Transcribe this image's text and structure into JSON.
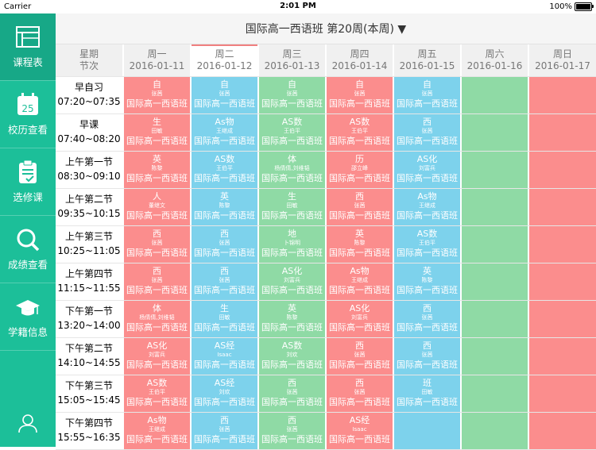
{
  "status_bar": {
    "carrier": "Carrier",
    "time": "2:01 PM",
    "battery": "100%"
  },
  "sidebar": {
    "items": [
      {
        "label": "课程表",
        "icon": "timetable-icon",
        "active": true
      },
      {
        "label": "校历查看",
        "icon": "calendar-icon",
        "day": "25"
      },
      {
        "label": "选修课",
        "icon": "elective-list-icon"
      },
      {
        "label": "成绩查看",
        "icon": "search-icon"
      },
      {
        "label": "学籍信息",
        "icon": "graduation-cap-icon"
      }
    ],
    "profile_icon": "user-icon"
  },
  "header": {
    "title": "国际高一西语班  第20周(本周) ▼"
  },
  "grid": {
    "corner": {
      "line1": "星期",
      "line2": "节次"
    },
    "days": [
      {
        "name": "周一",
        "date": "2016-01-11"
      },
      {
        "name": "周二",
        "date": "2016-01-12",
        "today": true
      },
      {
        "name": "周三",
        "date": "2016-01-13"
      },
      {
        "name": "周四",
        "date": "2016-01-14"
      },
      {
        "name": "周五",
        "date": "2016-01-15"
      },
      {
        "name": "周六",
        "date": "2016-01-16"
      },
      {
        "name": "周日",
        "date": "2016-01-17"
      }
    ],
    "periods": [
      {
        "name": "早自习",
        "time": "07:20~07:35"
      },
      {
        "name": "早课",
        "time": "07:40~08:20"
      },
      {
        "name": "上午第一节",
        "time": "08:30~09:10"
      },
      {
        "name": "上午第二节",
        "time": "09:35~10:15"
      },
      {
        "name": "上午第三节",
        "time": "10:25~11:05"
      },
      {
        "name": "上午第四节",
        "time": "11:15~11:55"
      },
      {
        "name": "下午第一节",
        "time": "13:20~14:00"
      },
      {
        "name": "下午第二节",
        "time": "14:10~14:55"
      },
      {
        "name": "下午第三节",
        "time": "15:05~15:45"
      },
      {
        "name": "下午第四节",
        "time": "15:55~16:35"
      }
    ],
    "day_colors": [
      "red",
      "blue",
      "green",
      "red",
      "blue",
      "green",
      "red"
    ],
    "colors": {
      "red": "#fb8d8d",
      "blue": "#7dd2ec",
      "green": "#8fdaa5",
      "sidebar": "#1cbf99"
    },
    "class_name": "国际高一西语班",
    "schedule": [
      [
        {
          "s": "自",
          "t": "张茜"
        },
        {
          "s": "自",
          "t": "张茜"
        },
        {
          "s": "自",
          "t": "张茜"
        },
        {
          "s": "自",
          "t": "张茜"
        },
        {
          "s": "自",
          "t": "张茜"
        },
        null,
        null
      ],
      [
        {
          "s": "生",
          "t": "田敏"
        },
        {
          "s": "As物",
          "t": "王继成"
        },
        {
          "s": "AS数",
          "t": "王伯平"
        },
        {
          "s": "AS数",
          "t": "王伯平"
        },
        {
          "s": "西",
          "t": "张茜"
        },
        null,
        null
      ],
      [
        {
          "s": "英",
          "t": "陈黎"
        },
        {
          "s": "AS数",
          "t": "王伯平"
        },
        {
          "s": "体",
          "t": "杨倩倩,刘维韬"
        },
        {
          "s": "历",
          "t": "邵立峰"
        },
        {
          "s": "AS化",
          "t": "刘富兵"
        },
        null,
        null
      ],
      [
        {
          "s": "人",
          "t": "董继文"
        },
        {
          "s": "英",
          "t": "陈黎"
        },
        {
          "s": "生",
          "t": "田敏"
        },
        {
          "s": "西",
          "t": "张茜"
        },
        {
          "s": "As物",
          "t": "王继成"
        },
        null,
        null
      ],
      [
        {
          "s": "西",
          "t": "张茜"
        },
        {
          "s": "西",
          "t": "张茜"
        },
        {
          "s": "地",
          "t": "卜锦明"
        },
        {
          "s": "英",
          "t": "陈黎"
        },
        {
          "s": "AS数",
          "t": "王伯平"
        },
        null,
        null
      ],
      [
        {
          "s": "西",
          "t": "张茜"
        },
        {
          "s": "西",
          "t": "张茜"
        },
        {
          "s": "AS化",
          "t": "刘富兵"
        },
        {
          "s": "As物",
          "t": "王继成"
        },
        {
          "s": "英",
          "t": "陈黎"
        },
        null,
        null
      ],
      [
        {
          "s": "体",
          "t": "杨倩倩,刘维韬"
        },
        {
          "s": "生",
          "t": "田敏"
        },
        {
          "s": "英",
          "t": "陈黎"
        },
        {
          "s": "AS化",
          "t": "刘富兵"
        },
        {
          "s": "西",
          "t": "张茜"
        },
        null,
        null
      ],
      [
        {
          "s": "AS化",
          "t": "刘富兵"
        },
        {
          "s": "AS经",
          "t": "Isaac"
        },
        {
          "s": "AS数",
          "t": "刘欢"
        },
        {
          "s": "西",
          "t": "张茜"
        },
        {
          "s": "西",
          "t": "张茜"
        },
        null,
        null
      ],
      [
        {
          "s": "AS数",
          "t": "王伯平"
        },
        {
          "s": "AS经",
          "t": "刘欢"
        },
        {
          "s": "西",
          "t": "张茜"
        },
        {
          "s": "西",
          "t": "张茜"
        },
        {
          "s": "班",
          "t": "田敏"
        },
        null,
        null
      ],
      [
        {
          "s": "As物",
          "t": "王继成"
        },
        {
          "s": "西",
          "t": "张茜"
        },
        {
          "s": "西",
          "t": "张茜"
        },
        {
          "s": "AS经",
          "t": "Isaac"
        },
        null,
        null,
        null
      ]
    ]
  }
}
